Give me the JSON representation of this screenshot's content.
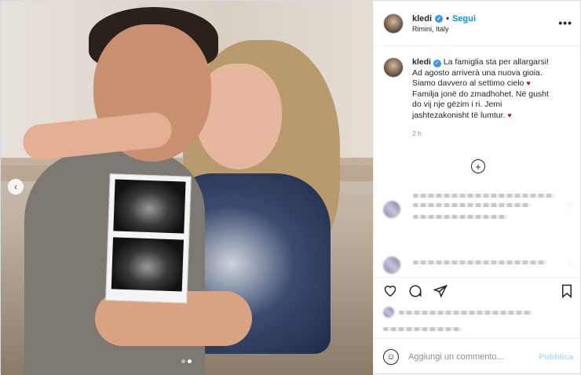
{
  "post": {
    "username": "kledi",
    "follow_label": "Segui",
    "location": "Rimini, Italy",
    "more_label": "•••",
    "verified_glyph": "✓"
  },
  "caption": {
    "username": "kledi",
    "line1": "La famiglia sta per allargarsi!",
    "line2": "Ad agosto arriverà una nuova gioia.",
    "line3": "Siamo davvero al settimo cielo",
    "line4": "Familja jonë do zmadhohet. Në gusht",
    "line5": "do vij nje gëzim i ri. Jemi",
    "line6": "jashtezakonisht të lumtur.",
    "heart": "♥",
    "time": "2 h"
  },
  "load_more": "+",
  "comment_box": {
    "placeholder": "Aggiungi un commento...",
    "publish_label": "Pubblica",
    "emoji_glyph": "☺"
  },
  "icons": {
    "like": "heart-outline-icon",
    "comment": "comment-icon",
    "share": "paper-plane-icon",
    "save": "bookmark-icon",
    "prev": "chevron-left-icon"
  },
  "carousel": {
    "prev_glyph": "‹",
    "slide_index": 2,
    "slide_count": 2
  },
  "colors": {
    "accent": "#0095f6",
    "verified": "#3897f0",
    "heart": "#c0121f"
  }
}
